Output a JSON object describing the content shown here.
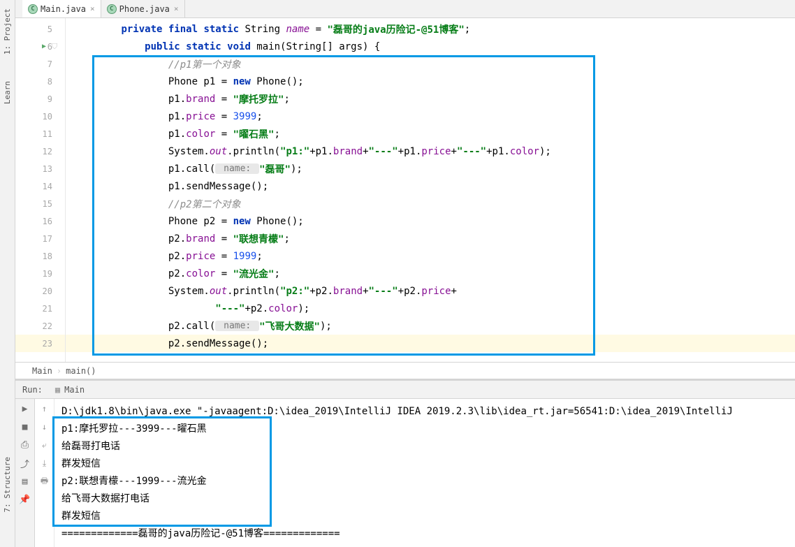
{
  "tabs": [
    {
      "label": "Main.java",
      "active": true
    },
    {
      "label": "Phone.java",
      "active": false
    }
  ],
  "sidebar_tools": {
    "project": "1: Project",
    "learn": "Learn",
    "structure": "7: Structure"
  },
  "gutter": {
    "start": 5,
    "end": 23,
    "run_line": 6,
    "shield_line": 6,
    "current": 23
  },
  "code": {
    "l5": {
      "indent": "        ",
      "kw1": "private final static",
      "type": " String ",
      "name": "name",
      "eq": " = ",
      "str": "\"磊哥的java历险记-@51博客\"",
      "semi": ";"
    },
    "l6": {
      "indent": "            ",
      "kw1": "public static void",
      "rest": " main(String[] args) {"
    },
    "l7": {
      "indent": "                ",
      "comment": "//p1第一个对象"
    },
    "l8": {
      "indent": "                ",
      "t1": "Phone p1 = ",
      "kw": "new",
      "t2": " Phone();"
    },
    "l9": {
      "indent": "                ",
      "t1": "p1.",
      "f": "brand",
      "t2": " = ",
      "s": "\"摩托罗拉\"",
      "t3": ";"
    },
    "l10": {
      "indent": "                ",
      "t1": "p1.",
      "f": "price",
      "t2": " = ",
      "n": "3999",
      "t3": ";"
    },
    "l11": {
      "indent": "                ",
      "t1": "p1.",
      "f": "color",
      "t2": " = ",
      "s": "\"曜石黑\"",
      "t3": ";"
    },
    "l12": {
      "indent": "                ",
      "t1": "System.",
      "out": "out",
      "t2": ".println(",
      "s1": "\"p1:\"",
      "t3": "+p1.",
      "f1": "brand",
      "t4": "+",
      "s2": "\"---\"",
      "t5": "+p1.",
      "f2": "price",
      "t6": "+",
      "s3": "\"---\"",
      "t7": "+p1.",
      "f3": "color",
      "t8": ");"
    },
    "l13": {
      "indent": "                ",
      "t1": "p1.call(",
      "hint": " name: ",
      "s": "\"磊哥\"",
      "t2": ");"
    },
    "l14": {
      "indent": "                ",
      "t1": "p1.sendMessage();"
    },
    "l15": {
      "indent": "                ",
      "comment": "//p2第二个对象"
    },
    "l16": {
      "indent": "                ",
      "t1": "Phone p2 = ",
      "kw": "new",
      "t2": " Phone();"
    },
    "l17": {
      "indent": "                ",
      "t1": "p2.",
      "f": "brand",
      "t2": " = ",
      "s": "\"联想青檬\"",
      "t3": ";"
    },
    "l18": {
      "indent": "                ",
      "t1": "p2.",
      "f": "price",
      "t2": " = ",
      "n": "1999",
      "t3": ";"
    },
    "l19": {
      "indent": "                ",
      "t1": "p2.",
      "f": "color",
      "t2": " = ",
      "s": "\"流光金\"",
      "t3": ";"
    },
    "l20": {
      "indent": "                ",
      "t1": "System.",
      "out": "out",
      "t2": ".println(",
      "s1": "\"p2:\"",
      "t3": "+p2.",
      "f1": "brand",
      "t4": "+",
      "s2": "\"---\"",
      "t5": "+p2.",
      "f2": "price",
      "t6": "+"
    },
    "l21": {
      "indent": "                        ",
      "s": "\"---\"",
      "t1": "+p2.",
      "f": "color",
      "t2": ");"
    },
    "l22": {
      "indent": "                ",
      "t1": "p2.call(",
      "hint": " name: ",
      "s": "\"飞哥大数据\"",
      "t2": ");"
    },
    "l23": {
      "indent": "                ",
      "t1": "p2.sendMessage();"
    }
  },
  "breadcrumb": {
    "class": "Main",
    "method": "main()"
  },
  "run": {
    "label": "Run:",
    "config": "Main"
  },
  "console": {
    "cmd": "D:\\jdk1.8\\bin\\java.exe \"-javaagent:D:\\idea_2019\\IntelliJ IDEA 2019.2.3\\lib\\idea_rt.jar=56541:D:\\idea_2019\\IntelliJ",
    "lines": [
      "p1:摩托罗拉---3999---曜石黑",
      "给磊哥打电话",
      "群发短信",
      "p2:联想青檬---1999---流光金",
      "给飞哥大数据打电话",
      "群发短信",
      "=============磊哥的java历险记-@51博客============="
    ]
  }
}
